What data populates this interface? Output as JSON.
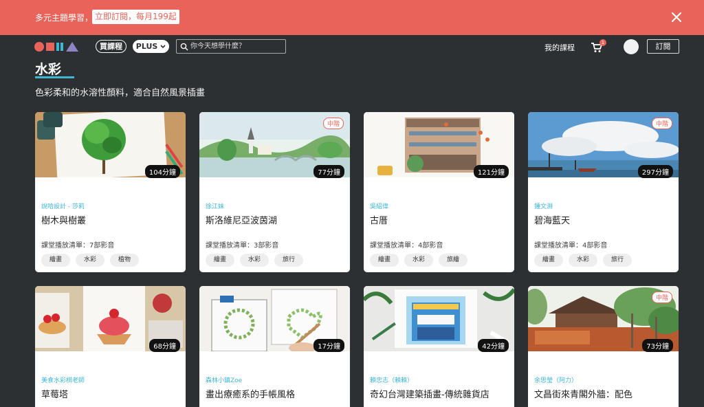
{
  "promo": {
    "text": "多元主題學習，",
    "cta": "立即訂閱，每月199起"
  },
  "nav": {
    "buy_courses": "買課程",
    "plus": "PLUS",
    "search_placeholder": "你今天想學什麼？",
    "my_courses": "我的課程",
    "cart_count": "1",
    "subscribe": "訂閱",
    "logo_colors": [
      "#e8645a",
      "#3fb6d3",
      "#8d84c4"
    ]
  },
  "page": {
    "title": "水彩",
    "subtitle": "色彩柔和的水溶性顏料，適合自然風景插畫"
  },
  "courses": [
    {
      "author": "說哈設計 - 莎莉",
      "title": "樹木與樹叢",
      "duration": "104分鐘",
      "level": "",
      "playlist": "課堂播放清單：7部影音",
      "tags": [
        "繪畫",
        "水彩",
        "植物"
      ]
    },
    {
      "author": "徐江妹",
      "title": "斯洛維尼亞波茵湖",
      "duration": "77分鐘",
      "level": "中階",
      "playlist": "課堂播放清單：3部影音",
      "tags": [
        "繪畫",
        "水彩",
        "旅行"
      ]
    },
    {
      "author": "吳紹偉",
      "title": "古厝",
      "duration": "121分鐘",
      "level": "",
      "playlist": "課堂播放清單：4部影音",
      "tags": [
        "繪畫",
        "水彩",
        "旅繪"
      ]
    },
    {
      "author": "鍾文淵",
      "title": "碧海藍天",
      "duration": "297分鐘",
      "level": "中階",
      "playlist": "課堂播放清單：4部影音",
      "tags": [
        "繪畫",
        "水彩",
        "旅行"
      ]
    },
    {
      "author": "美食水彩棋老師",
      "title": "草莓塔",
      "duration": "68分鐘",
      "level": ""
    },
    {
      "author": "森林小鎮Zoe",
      "title": "畫出療癒系的手帳風格",
      "duration": "17分鐘",
      "level": ""
    },
    {
      "author": "賴忠志（賴賴）",
      "title": "奇幻台灣建築插畫-傳統雜貨店",
      "duration": "42分鐘",
      "level": ""
    },
    {
      "author": "余思瑩（阿力）",
      "title": "文昌街來青閣外牆：配色",
      "duration": "73分鐘",
      "level": "中階"
    }
  ]
}
